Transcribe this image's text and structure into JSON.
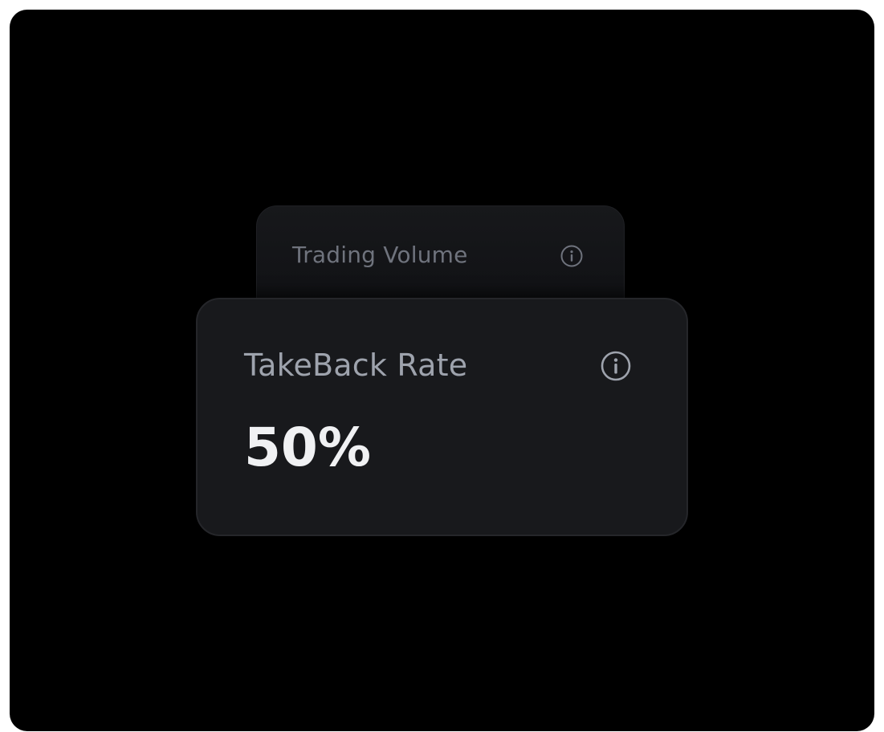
{
  "cards": {
    "back": {
      "title": "Trading Volume",
      "icon": "info-icon"
    },
    "front": {
      "title": "TakeBack Rate",
      "value": "50%",
      "icon": "info-icon"
    }
  },
  "colors": {
    "background": "#000000",
    "card_front": "#18191c",
    "card_back": "#141518",
    "title_front": "#9ea3ad",
    "title_back": "#6f737d",
    "value": "#f0f1f3"
  }
}
